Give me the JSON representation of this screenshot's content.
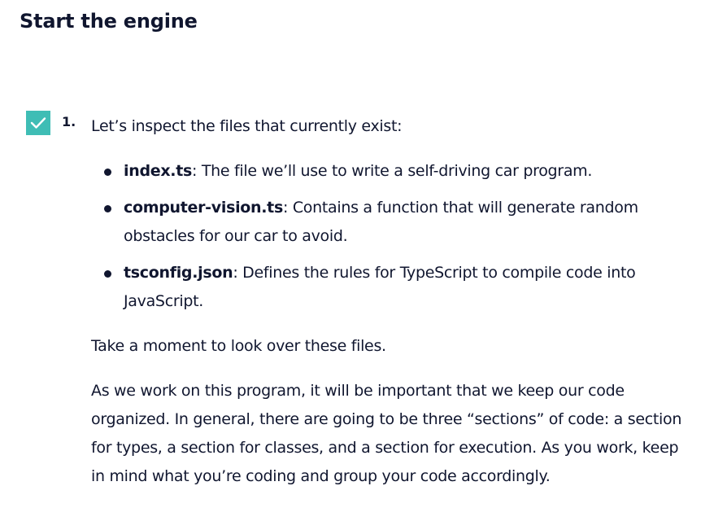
{
  "heading": "Start the engine",
  "task": {
    "number": "1.",
    "checked": true,
    "accent_color": "#3fbdb5",
    "intro": "Let’s inspect the files that currently exist:",
    "files": [
      {
        "name": "index.ts",
        "desc": ": The file we’ll use to write a self-driving car program."
      },
      {
        "name": "computer-vision.ts",
        "desc": ": Contains a function that will generate random obstacles for our car to avoid."
      },
      {
        "name": "tsconfig.json",
        "desc": ": Defines the rules for TypeScript to compile code into JavaScript."
      }
    ],
    "paragraph1": "Take a moment to look over these files.",
    "paragraph2": "As we work on this program, it will be important that we keep our code organized. In general, there are going to be three “sections” of code: a section for types, a section for classes, and a section for execution. As you work, keep in mind what you’re coding and group your code accordingly."
  }
}
